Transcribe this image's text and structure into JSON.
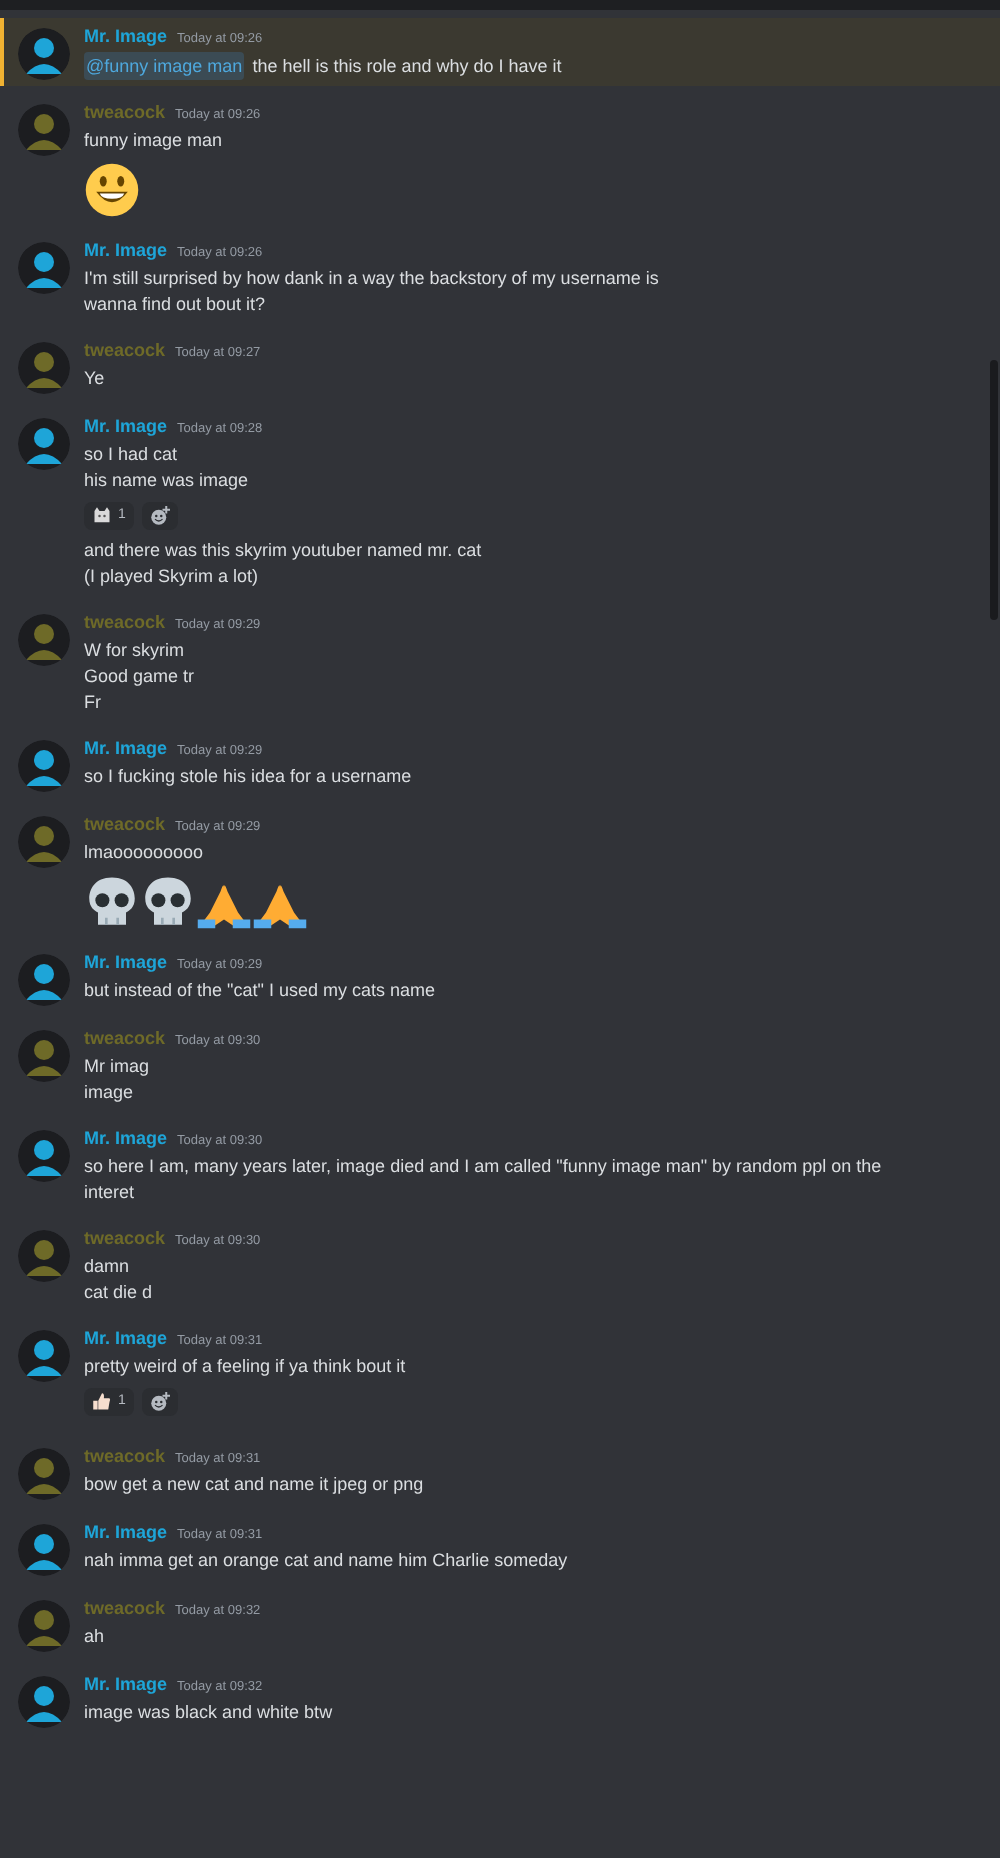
{
  "messages": [
    {
      "author": "Mr. Image",
      "color": "#1ea5d8",
      "time": "Today at 09:26",
      "highlighted": true,
      "lines": [
        {
          "kind": "mention",
          "mention": "@funny image man",
          "text": "the hell is this role and why do I have it"
        }
      ]
    },
    {
      "author": "tweacock",
      "color": "#6e6a28",
      "time": "Today at 09:26",
      "highlighted": false,
      "lines": [
        {
          "kind": "text",
          "text": "funny image man"
        },
        {
          "kind": "emoji",
          "items": [
            {
              "kind": "smile"
            }
          ]
        }
      ]
    },
    {
      "author": "Mr. Image",
      "color": "#1ea5d8",
      "time": "Today at 09:26",
      "highlighted": false,
      "lines": [
        {
          "kind": "text",
          "text": "I'm still surprised by how dank in a way the backstory of my username is"
        },
        {
          "kind": "text",
          "text": "wanna find out bout it?"
        }
      ]
    },
    {
      "author": "tweacock",
      "color": "#6e6a28",
      "time": "Today at 09:27",
      "highlighted": false,
      "lines": [
        {
          "kind": "text",
          "text": "Ye"
        }
      ]
    },
    {
      "author": "Mr. Image",
      "color": "#1ea5d8",
      "time": "Today at 09:28",
      "highlighted": false,
      "lines": [
        {
          "kind": "text",
          "text": "so I had cat"
        },
        {
          "kind": "text",
          "text": "his name was image"
        },
        {
          "kind": "reactions",
          "items": [
            {
              "kind": "cat",
              "count": "1"
            }
          ]
        },
        {
          "kind": "text",
          "text": "and there was this skyrim youtuber named mr. cat"
        },
        {
          "kind": "text",
          "text": "(I played Skyrim a lot)"
        }
      ]
    },
    {
      "author": "tweacock",
      "color": "#6e6a28",
      "time": "Today at 09:29",
      "highlighted": false,
      "lines": [
        {
          "kind": "text",
          "text": "W for skyrim"
        },
        {
          "kind": "text",
          "text": "Good game tr"
        },
        {
          "kind": "text",
          "text": "Fr"
        }
      ]
    },
    {
      "author": "Mr. Image",
      "color": "#1ea5d8",
      "time": "Today at 09:29",
      "highlighted": false,
      "lines": [
        {
          "kind": "text",
          "text": "so I fucking stole his idea for a username"
        }
      ]
    },
    {
      "author": "tweacock",
      "color": "#6e6a28",
      "time": "Today at 09:29",
      "highlighted": false,
      "lines": [
        {
          "kind": "text",
          "text": "lmaooooooooo"
        },
        {
          "kind": "emoji",
          "items": [
            {
              "kind": "skull"
            },
            {
              "kind": "skull"
            },
            {
              "kind": "pray"
            },
            {
              "kind": "pray"
            }
          ]
        }
      ]
    },
    {
      "author": "Mr. Image",
      "color": "#1ea5d8",
      "time": "Today at 09:29",
      "highlighted": false,
      "lines": [
        {
          "kind": "text",
          "text": "but instead of the \"cat\" I used my cats name"
        }
      ]
    },
    {
      "author": "tweacock",
      "color": "#6e6a28",
      "time": "Today at 09:30",
      "highlighted": false,
      "lines": [
        {
          "kind": "text",
          "text": "Mr imag"
        },
        {
          "kind": "text",
          "text": "image"
        }
      ]
    },
    {
      "author": "Mr. Image",
      "color": "#1ea5d8",
      "time": "Today at 09:30",
      "highlighted": false,
      "lines": [
        {
          "kind": "text",
          "text": "so here I am, many years later, image died and I am called \"funny image man\" by random ppl on the interet"
        }
      ]
    },
    {
      "author": "tweacock",
      "color": "#6e6a28",
      "time": "Today at 09:30",
      "highlighted": false,
      "lines": [
        {
          "kind": "text",
          "text": "damn"
        },
        {
          "kind": "text",
          "text": "cat die d"
        }
      ]
    },
    {
      "author": "Mr. Image",
      "color": "#1ea5d8",
      "time": "Today at 09:31",
      "highlighted": false,
      "lines": [
        {
          "kind": "text",
          "text": "pretty weird of a feeling if ya think bout it"
        },
        {
          "kind": "reactions",
          "items": [
            {
              "kind": "thumbs",
              "count": "1"
            }
          ]
        }
      ]
    },
    {
      "author": "tweacock",
      "color": "#6e6a28",
      "time": "Today at 09:31",
      "highlighted": false,
      "lines": [
        {
          "kind": "text",
          "text": "bow get a new cat and name it jpeg or png"
        }
      ]
    },
    {
      "author": "Mr. Image",
      "color": "#1ea5d8",
      "time": "Today at 09:31",
      "highlighted": false,
      "lines": [
        {
          "kind": "text",
          "text": "nah imma get an orange cat and name him Charlie someday"
        }
      ]
    },
    {
      "author": "tweacock",
      "color": "#6e6a28",
      "time": "Today at 09:32",
      "highlighted": false,
      "lines": [
        {
          "kind": "text",
          "text": "ah"
        }
      ]
    },
    {
      "author": "Mr. Image",
      "color": "#1ea5d8",
      "time": "Today at 09:32",
      "highlighted": false,
      "lines": [
        {
          "kind": "text",
          "text": "image was black and white btw"
        }
      ]
    }
  ]
}
